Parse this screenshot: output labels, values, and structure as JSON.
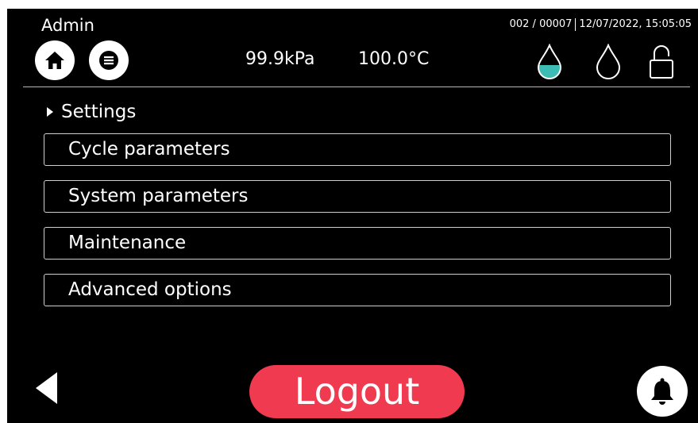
{
  "header": {
    "user": "Admin",
    "cycle_counter": "002 / 00007",
    "datetime": "12/07/2022, 15:05:05",
    "pressure": "99.9kPa",
    "temperature": "100.0°C",
    "icons": {
      "home": "home-icon",
      "menu": "menu-icon",
      "water_full": "water-drop-full-icon",
      "water_empty": "water-drop-empty-icon",
      "lock": "lock-open-icon"
    },
    "water_fill_color": "#3dbcb5"
  },
  "settings": {
    "title": "Settings",
    "items": [
      {
        "label": "Cycle parameters"
      },
      {
        "label": "System parameters"
      },
      {
        "label": "Maintenance"
      },
      {
        "label": "Advanced options"
      }
    ]
  },
  "footer": {
    "logout_label": "Logout",
    "logout_color": "#f03a4f",
    "back_icon": "back-arrow-icon",
    "bell_icon": "bell-icon"
  }
}
